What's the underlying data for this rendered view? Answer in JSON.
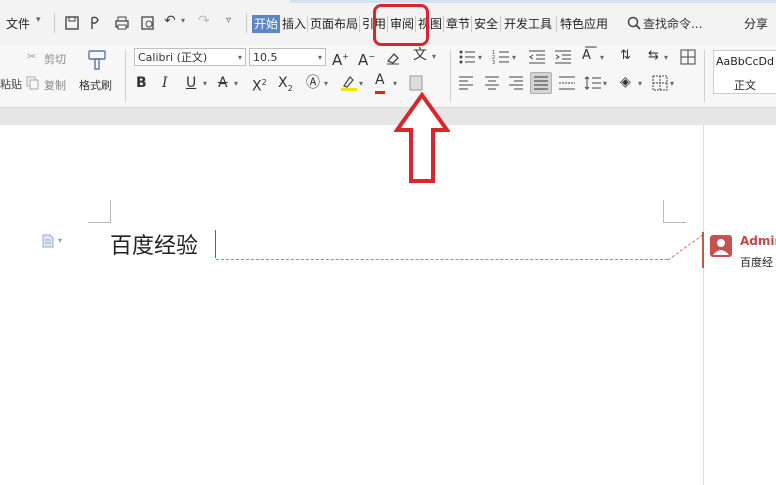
{
  "menu": {
    "file_label": "文件",
    "tabs": [
      "开始",
      "插入",
      "页面布局",
      "引用",
      "审阅",
      "视图",
      "章节",
      "安全",
      "开发工具",
      "特色应用"
    ],
    "active_tab": "开始",
    "search_text": "查找命令...",
    "share_label": "分享"
  },
  "ribbon": {
    "cut_label": "剪切",
    "copy_label": "复制",
    "paste_label": "粘贴",
    "format_painter_label": "格式刷",
    "font_name": "Calibri (正文)",
    "font_size": "10.5",
    "bold_label": "B",
    "italic_label": "I",
    "underline_label": "U",
    "style_preview": "AaBbCcDd",
    "style_name": "正文"
  },
  "document": {
    "text": "百度经验"
  },
  "comment": {
    "author": "Admin",
    "text": "百度经"
  },
  "colors": {
    "active_tab": "#5b87c8",
    "highlight_red": "#d8262e",
    "comment_red": "#c95050"
  }
}
